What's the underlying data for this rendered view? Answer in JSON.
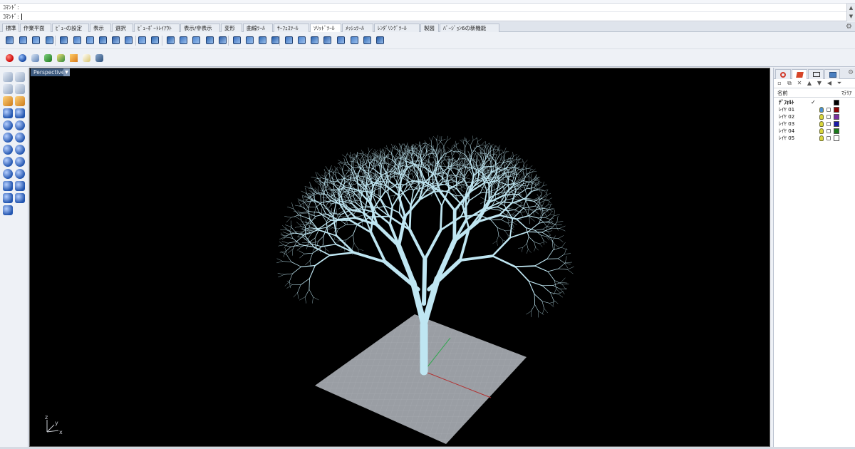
{
  "command": {
    "history_text": "ｺﾏﾝﾄﾞ:",
    "prompt_text": "ｺﾏﾝﾄﾞ:"
  },
  "tabs": [
    {
      "label": "標準"
    },
    {
      "label": "作業平面"
    },
    {
      "label": "ﾋﾞｭｰの設定"
    },
    {
      "label": "表示"
    },
    {
      "label": "選択"
    },
    {
      "label": "ﾋﾞｭｰﾎﾟｰﾄﾚｲｱｳﾄ"
    },
    {
      "label": "表示/非表示"
    },
    {
      "label": "変形"
    },
    {
      "label": "曲線ﾂｰﾙ"
    },
    {
      "label": "ｻｰﾌｪｽﾂｰﾙ"
    },
    {
      "label": "ｿﾘｯﾄﾞﾂｰﾙ"
    },
    {
      "label": "ﾒｯｼｭﾂｰﾙ"
    },
    {
      "label": "ﾚﾝﾀﾞﾘﾝｸﾞﾂｰﾙ"
    },
    {
      "label": "製図"
    },
    {
      "label": "ﾊﾞｰｼﾞｮﾝ6の新機能"
    }
  ],
  "active_tab": "ｿﾘｯﾄﾞﾂｰﾙ",
  "viewport": {
    "title": "Perspective",
    "dropdown_icon": "chevron-down-icon",
    "axis_labels": {
      "z": "z",
      "y": "y",
      "x": "x"
    },
    "background_color": "#000000",
    "model_color": "#bfe6f2",
    "plane_color": "#9a9ea4"
  },
  "layers_panel": {
    "column_name": "名前",
    "column_material": "ﾏﾃﾘｱ",
    "current_mark": "✓",
    "layers": [
      {
        "name": "ﾃﾞﾌｫﾙﾄ",
        "current": true,
        "color": "#000000"
      },
      {
        "name": "ﾚｲﾔ 01",
        "current": false,
        "color": "#8b0000"
      },
      {
        "name": "ﾚｲﾔ 02",
        "current": false,
        "color": "#7a2fa0"
      },
      {
        "name": "ﾚｲﾔ 03",
        "current": false,
        "color": "#1a1aa8"
      },
      {
        "name": "ﾚｲﾔ 04",
        "current": false,
        "color": "#1a7a1a"
      },
      {
        "name": "ﾚｲﾔ 05",
        "current": false,
        "color": "#ffffff"
      }
    ]
  },
  "colors": {
    "accent": "#3d5a7e",
    "panel_bg": "#eef1f6"
  }
}
